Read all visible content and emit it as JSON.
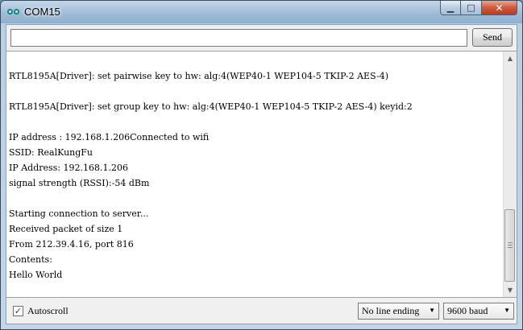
{
  "window": {
    "title": "COM15",
    "minimize_glyph": "▁",
    "maximize_glyph": "□",
    "close_glyph": "✕"
  },
  "send_bar": {
    "input_value": "",
    "input_placeholder": "",
    "send_label": "Send"
  },
  "console": {
    "lines": [
      "RTL8195A[Driver]: set pairwise key to hw: alg:4(WEP40-1 WEP104-5 TKIP-2 AES-4)",
      "",
      "RTL8195A[Driver]: set group key to hw: alg:4(WEP40-1 WEP104-5 TKIP-2 AES-4) keyid:2",
      "",
      "IP address : 192.168.1.206Connected to wifi",
      "SSID: RealKungFu",
      "IP Address: 192.168.1.206",
      "signal strength (RSSI):-54 dBm",
      "",
      "Starting connection to server...",
      "Received packet of size 1",
      "From 212.39.4.16, port 816",
      "Contents:",
      "Hello World"
    ]
  },
  "bottom_bar": {
    "autoscroll_label": "Autoscroll",
    "autoscroll_checked": true,
    "line_ending_selected": "No line ending",
    "baud_selected": "9600 baud"
  },
  "icons": {
    "app": "arduino-icon",
    "check": "✓",
    "dropdown": "▼",
    "scroll_up": "▲",
    "scroll_down": "▼"
  }
}
